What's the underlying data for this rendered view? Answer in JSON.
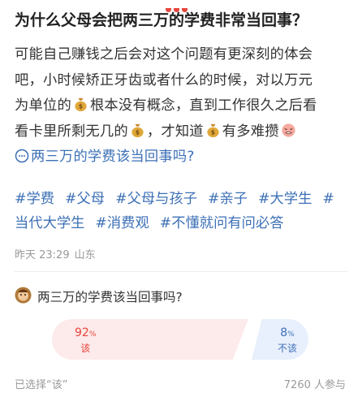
{
  "post": {
    "title": "为什么父母会把两三万的学费非常当回事？",
    "body_lines": {
      "l1": "可能自己赚钱之后会对这个问题有更深刻的体会",
      "l2": "吧，小时候矫正牙齿或者什么的时候，对以万元",
      "l3a": "为单位的",
      "l3b": "根本没有概念，直到工作很久之后看",
      "l4a": "看卡里所剩无几的",
      "l4b": "，才知道",
      "l4c": "有多难攒"
    },
    "topic_link": "两三万的学费该当回事吗?",
    "tags": [
      "#学费",
      "#父母",
      "#父母与孩子",
      "#亲子",
      "#大学生",
      "#",
      "当代大学生",
      "#消费观",
      "#不懂就问有问必答"
    ],
    "meta": {
      "time": "昨天 23:29",
      "location": "山东"
    }
  },
  "poll": {
    "question": "两三万的学费该当回事吗?",
    "options": [
      {
        "label": "该",
        "percent": "92",
        "percent_sign": "%"
      },
      {
        "label": "不该",
        "percent": "8",
        "percent_sign": "%"
      }
    ],
    "selected_text": "已选择“该”",
    "participants": "7260 人参与"
  },
  "icons": {
    "money_bag": "money-bag-emoji",
    "sweat_face": "tired-face-emoji",
    "topic": "topic-chat-icon",
    "avatar": "poll-avatar"
  },
  "colors": {
    "link": "#3d70b6",
    "accent_red": "#e8443a",
    "meta_gray": "#999999"
  }
}
